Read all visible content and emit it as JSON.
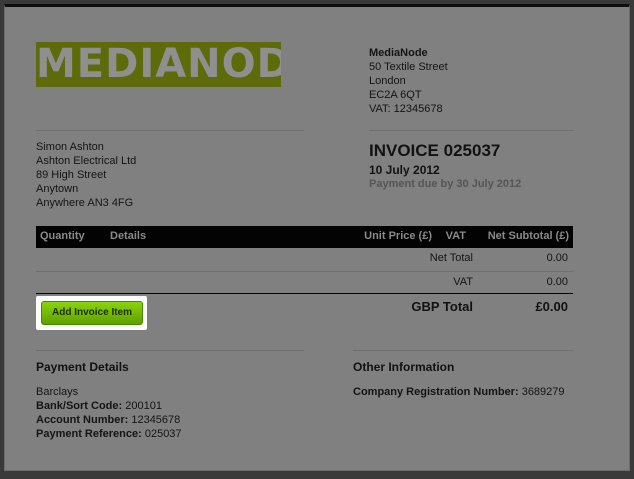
{
  "logo": {
    "text": "MEDIANODE",
    "color": "#5e6b0a"
  },
  "company": {
    "name": "MediaNode",
    "address": [
      "50 Textile Street",
      "London",
      "EC2A 6QT",
      "VAT: 12345678"
    ]
  },
  "client": {
    "lines": [
      "Simon Ashton",
      "Ashton Electrical Ltd",
      "89 High Street",
      "Anytown",
      "Anywhere AN3 4FG"
    ]
  },
  "invoice": {
    "title": "INVOICE 025037",
    "date": "10 July 2012",
    "due": "Payment due by 30 July 2012"
  },
  "table": {
    "headers": {
      "quantity": "Quantity",
      "details": "Details",
      "unit_price": "Unit Price (£)",
      "vat": "VAT",
      "net_subtotal": "Net Subtotal (£)"
    },
    "rows": [
      {
        "label": "Net Total",
        "value": "0.00"
      },
      {
        "label": "VAT",
        "value": "0.00"
      }
    ],
    "total_label": "GBP Total",
    "total_value": "£0.00"
  },
  "add_item_button": "Add Invoice Item",
  "payment": {
    "heading": "Payment Details",
    "bank": "Barclays",
    "sort_code_label": "Bank/Sort Code:",
    "sort_code_value": " 200101",
    "account_label": "Account Number:",
    "account_value": " 12345678",
    "reference_label": "Payment Reference:",
    "reference_value": " 025037"
  },
  "other": {
    "heading": "Other Information",
    "reg_label": "Company Registration Number:",
    "reg_value": " 3689279"
  },
  "colors": {
    "accent_green": "#7bc300",
    "background": "#808080",
    "table_header": "#030303"
  }
}
